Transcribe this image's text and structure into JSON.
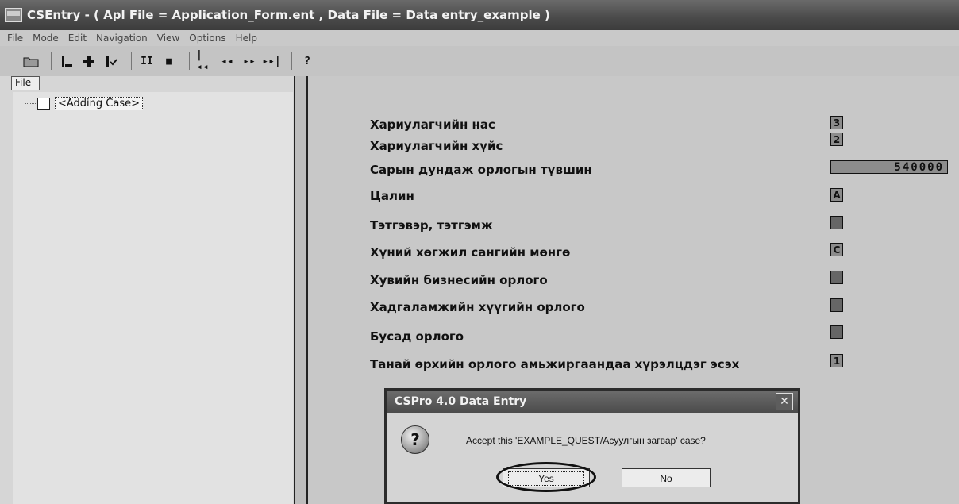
{
  "window": {
    "title": "CSEntry - ( Apl File = Application_Form.ent , Data File = Data entry_example )"
  },
  "menu": [
    "File",
    "Mode",
    "Edit",
    "Navigation",
    "View",
    "Options",
    "Help"
  ],
  "toolbar": {
    "icons": [
      "open-folder-icon",
      "add-case-icon",
      "insert-node-icon",
      "modify-case-icon",
      "pause-icon",
      "stop-icon",
      "first-icon",
      "prev-icon",
      "next-icon",
      "last-icon",
      "help-icon"
    ],
    "glyphs": {
      "pause": "II",
      "stop": "■",
      "first": "|◂◂",
      "prev": "◂◂",
      "next": "▸▸",
      "last": "▸▸|",
      "help": "?"
    }
  },
  "left": {
    "tab": "File",
    "case": "<Adding Case>"
  },
  "fields": [
    {
      "label": "Хариулагчийн нас",
      "value": "3"
    },
    {
      "label": "Хариулагчийн хүйс",
      "value": "2"
    },
    {
      "label": "Сарын дундаж орлогын түвшин",
      "value": "540000"
    },
    {
      "label": "Цалин",
      "value": "A"
    },
    {
      "label": "Тэтгэвэр, тэтгэмж",
      "value": ""
    },
    {
      "label": "Хүний хөгжил сангийн мөнгө",
      "value": "C"
    },
    {
      "label": "Хувийн бизнесийн орлого",
      "value": ""
    },
    {
      "label": "Хадгаламжийн хүүгийн орлого",
      "value": ""
    },
    {
      "label": "Бусад орлого",
      "value": ""
    },
    {
      "label": "Танай өрхийн орлого амьжиргаандаа хүрэлцдэг эсэх",
      "value": "1"
    }
  ],
  "dialog": {
    "title": "CSPro 4.0 Data Entry",
    "message": "Accept this 'EXAMPLE_QUEST/Асуулгын загвар' case?",
    "yes": "Yes",
    "no": "No",
    "close": "✕",
    "icon": "question-icon"
  }
}
